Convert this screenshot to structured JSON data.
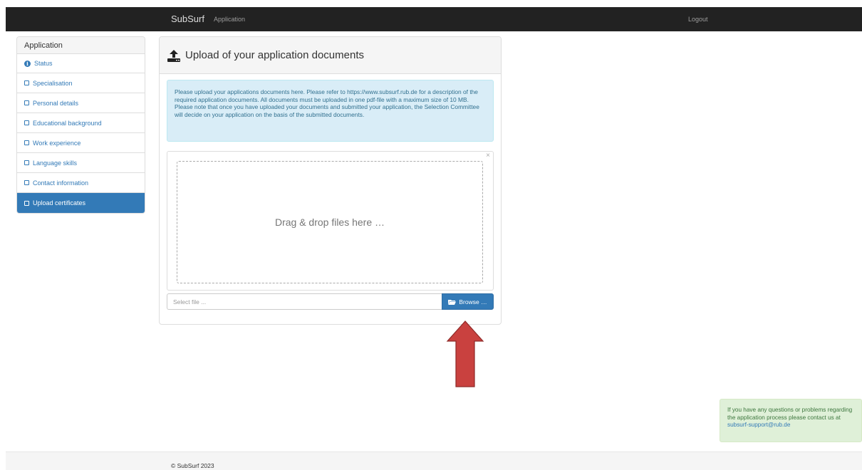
{
  "navbar": {
    "brand": "SubSurf",
    "app_link": "Application",
    "logout": "Logout"
  },
  "sidebar": {
    "heading": "Application",
    "items": [
      {
        "label": "Status",
        "icon": "info-icon"
      },
      {
        "label": "Specialisation",
        "icon": "checkbox-icon"
      },
      {
        "label": "Personal details",
        "icon": "checkbox-icon"
      },
      {
        "label": "Educational background",
        "icon": "checkbox-icon"
      },
      {
        "label": "Work experience",
        "icon": "checkbox-icon"
      },
      {
        "label": "Language skills",
        "icon": "checkbox-icon"
      },
      {
        "label": "Contact information",
        "icon": "checkbox-icon"
      },
      {
        "label": "Upload certificates",
        "icon": "checkbox-icon",
        "active": true
      }
    ]
  },
  "main": {
    "title": "Upload of your application documents",
    "info_line1": "Please upload your applications documents here. Please refer to https://www.subsurf.rub.de for a description of the required application documents. All documents must be uploaded in one pdf-file with a maximum size of 10 MB.",
    "info_line2": "Please note that once you have uploaded your documents and submitted your application, the Selection Committee will decide on your application on the basis of the submitted documents.",
    "close_symbol": "×",
    "drop_text": "Drag & drop files here …",
    "file_placeholder": "Select file ...",
    "browse_label": "Browse …"
  },
  "support": {
    "text": "If you have any questions or problems regarding the application process please contact us at ",
    "email": "subsurf-support@rub.de"
  },
  "footer": {
    "text": "© SubSurf 2023"
  },
  "colors": {
    "navbar_bg": "#222222",
    "primary": "#337ab7",
    "info_bg": "#d9edf7",
    "success_bg": "#dff0d8",
    "arrow": "#c9413f"
  }
}
